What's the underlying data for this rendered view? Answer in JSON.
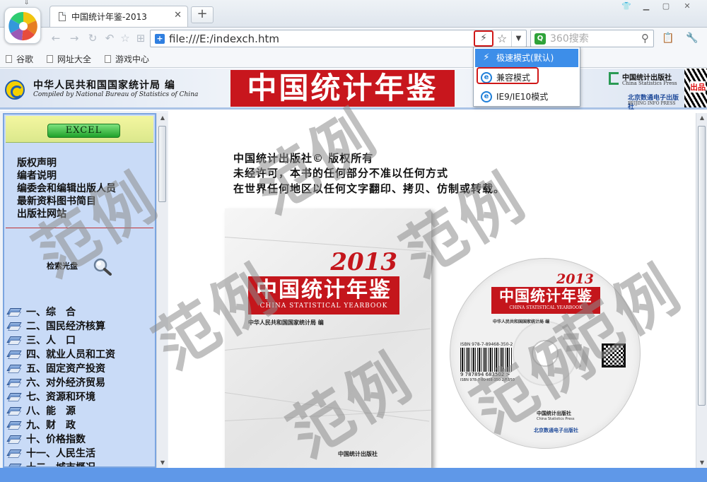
{
  "browser": {
    "tab_title": "中国统计年鉴-2013",
    "tab_close": "✕",
    "new_tab": "+",
    "address": "file:///E:/indexch.htm",
    "search_placeholder": "360搜索",
    "bookmarks": [
      "谷歌",
      "网址大全",
      "游戏中心"
    ],
    "mode_menu": {
      "items": [
        {
          "label": "极速模式(默认)",
          "icon": "lightning-icon",
          "selected": true
        },
        {
          "label": "兼容模式",
          "icon": "ie-icon",
          "selected": false,
          "highlighted": true
        },
        {
          "label": "IE9/IE10模式",
          "icon": "ie-icon",
          "selected": false
        }
      ]
    }
  },
  "banner": {
    "compiled_cn": "中华人民共和国国家统计局 编",
    "compiled_en": "Compiled by National Bureau of Statistics of China",
    "title": "中国统计年鉴",
    "press_cn": "中国统计出版社",
    "press_en": "China Statistics Press",
    "press2_cn": "北京数通电子出版社",
    "press2_en": "BEIJING INFO PRESS",
    "corner_text": "出品"
  },
  "sidebar": {
    "excel_label": "EXCEL",
    "links": [
      "版权声明",
      "编者说明",
      "编委会和编辑出版人员",
      "最新资料图书简目",
      "出版社网站"
    ],
    "search_cd_label": "检索光盘",
    "chapters": [
      "一、综　合",
      "二、国民经济核算",
      "三、人　口",
      "四、就业人员和工资",
      "五、固定资产投资",
      "六、对外经济贸易",
      "七、资源和环境",
      "八、能　源",
      "九、财　政",
      "十、价格指数",
      "十一、人民生活",
      "十二、城市概况"
    ]
  },
  "main": {
    "copyright_lines": [
      "中国统计出版社© 版权所有",
      "未经许可，本书的任何部分不准以任何方式",
      "在世界任何地区以任何文字翻印、拷贝、仿制或转载。"
    ],
    "cover": {
      "year": "2013",
      "title": "中国统计年鉴",
      "subtitle": "CHINA STATISTICAL YEARBOOK",
      "compiled": "中华人民共和国国家统计局 编",
      "press": "中国统计出版社"
    },
    "disc": {
      "year": "2013",
      "title": "中国统计年鉴",
      "subtitle": "CHINA STATISTICAL YEARBOOK",
      "compiled": "中华人民共和国国家统计局 编",
      "isbn_top": "ISBN 978-7-89468-350-2",
      "isbn_num": "9 787894 683502 >",
      "isbn_bottom": "ISBN 978-7-89468-350-2/F.550",
      "press_cn": "中国统计出版社",
      "press_en": "China Statistics Press",
      "press2": "北京数通电子出版社"
    }
  },
  "watermark": "范例",
  "colors": {
    "accent_red": "#c4161c",
    "sidebar_bg": "#c9dbf7",
    "menu_selected": "#3d8ee9",
    "status_bar": "#5f98e8"
  }
}
